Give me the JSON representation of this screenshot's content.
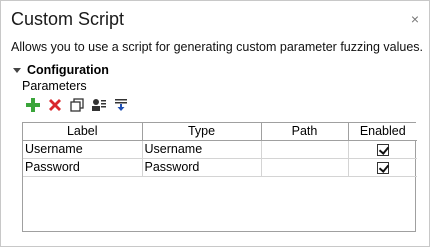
{
  "dialog": {
    "title": "Custom Script",
    "close_glyph": "×",
    "description": "Allows you to use a script for generating custom parameter fuzzing values."
  },
  "configuration": {
    "section_label": "Configuration",
    "parameters_label": "Parameters",
    "toolbar": [
      {
        "icon": "add-icon",
        "color": "#3aa53a"
      },
      {
        "icon": "delete-icon",
        "color": "#d9262c"
      },
      {
        "icon": "duplicate-icon",
        "color": "#333333"
      },
      {
        "icon": "import-icon",
        "color": "#333333"
      },
      {
        "icon": "move-down-icon",
        "color": "#1f4fb4"
      }
    ],
    "columns": [
      "Label",
      "Type",
      "Path",
      "Enabled"
    ],
    "rows": [
      {
        "label": "Username",
        "type": "Username",
        "path": "",
        "enabled": true
      },
      {
        "label": "Password",
        "type": "Password",
        "path": "",
        "enabled": true
      }
    ]
  }
}
